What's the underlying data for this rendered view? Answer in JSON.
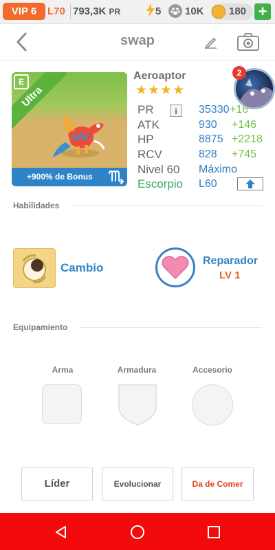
{
  "status_bar": {
    "vip": "VIP 6",
    "level": "L70",
    "power_total": "793,3K",
    "power_unit": "PR",
    "energy": "5",
    "food": "10K",
    "coins": "180",
    "add_label": "+"
  },
  "nav": {
    "title": "swap"
  },
  "creature": {
    "rarity": "Ultra",
    "element_badge": "E",
    "bonus": "+900% de Bonus",
    "name": "Aeroaptor",
    "stars": 4,
    "notification_count": "2",
    "stats": [
      {
        "label": "PR",
        "value": "35330",
        "bonus": "+16"
      },
      {
        "label": "ATK",
        "value": "930",
        "bonus": "+146"
      },
      {
        "label": "HP",
        "value": "8875",
        "bonus": "+2218"
      },
      {
        "label": "RCV",
        "value": "828",
        "bonus": "+745"
      },
      {
        "label": "Nivel 60",
        "value": "Máximo",
        "bonus": ""
      }
    ],
    "zodiac": "Escorpio",
    "zodiac_level": "L60"
  },
  "skills": {
    "title": "Habilidades",
    "primary": {
      "name": "Cambio"
    },
    "secondary": {
      "name": "Reparador",
      "level": "LV 1"
    }
  },
  "equipment": {
    "title": "Equipamiento",
    "slots": [
      "Arma",
      "Armadura",
      "Accesorio"
    ]
  },
  "actions": {
    "leader": "Líder",
    "evolve": "Evolucionar",
    "feed": "Da de Comer"
  },
  "colors": {
    "accent_blue": "#2f84c8",
    "bonus_green": "#6fbf46",
    "orange": "#e36b1f",
    "system_nav": "#f30a0a"
  }
}
